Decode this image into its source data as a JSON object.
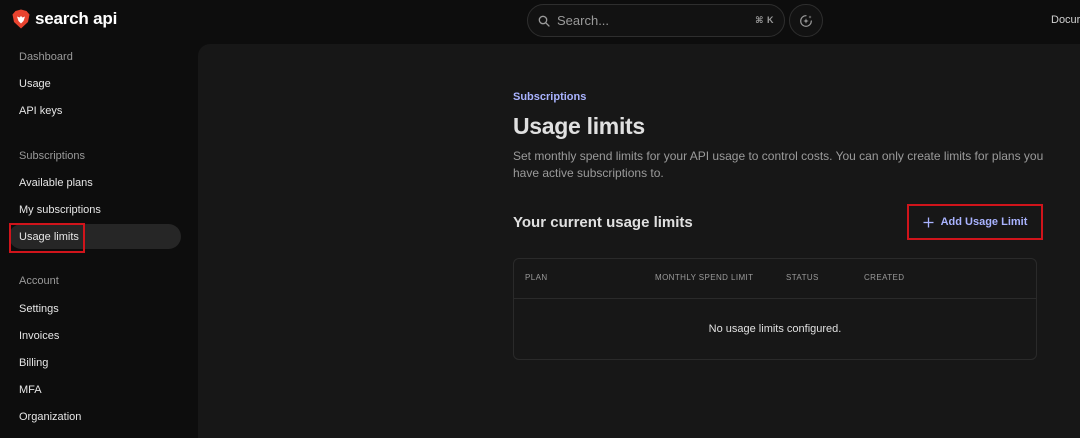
{
  "brand": {
    "name": "search api",
    "color": "#e8432f",
    "icon": "lion-shield-icon"
  },
  "search": {
    "placeholder": "Search...",
    "shortcut": "⌘ K",
    "icon": "search-icon"
  },
  "ai_button": {
    "icon": "sparkle-circle-icon"
  },
  "header": {
    "docs_label": "Docur"
  },
  "sidebar": {
    "dashboard": {
      "heading": "Dashboard",
      "items": [
        {
          "label": "Usage"
        },
        {
          "label": "API keys"
        }
      ]
    },
    "subscriptions": {
      "heading": "Subscriptions",
      "items": [
        {
          "label": "Available plans"
        },
        {
          "label": "My subscriptions"
        },
        {
          "label": "Usage limits",
          "active": true
        }
      ]
    },
    "account": {
      "heading": "Account",
      "items": [
        {
          "label": "Settings"
        },
        {
          "label": "Invoices"
        },
        {
          "label": "Billing"
        },
        {
          "label": "MFA"
        },
        {
          "label": "Organization"
        }
      ]
    }
  },
  "main": {
    "eyebrow": "Subscriptions",
    "title": "Usage limits",
    "description": "Set monthly spend limits for your API usage to control costs. You can only create limits for plans you have active subscriptions to.",
    "section_title": "Your current usage limits",
    "add_button": {
      "label": "Add Usage Limit",
      "icon": "plus-icon"
    },
    "table": {
      "columns": [
        "PLAN",
        "MONTHLY SPEND LIMIT",
        "STATUS",
        "CREATED"
      ],
      "rows": [],
      "empty_message": "No usage limits configured."
    }
  },
  "colors": {
    "accent": "#a9b3ff",
    "highlight": "#d0141b",
    "background": "#0d0d0d",
    "panel": "#171717"
  }
}
